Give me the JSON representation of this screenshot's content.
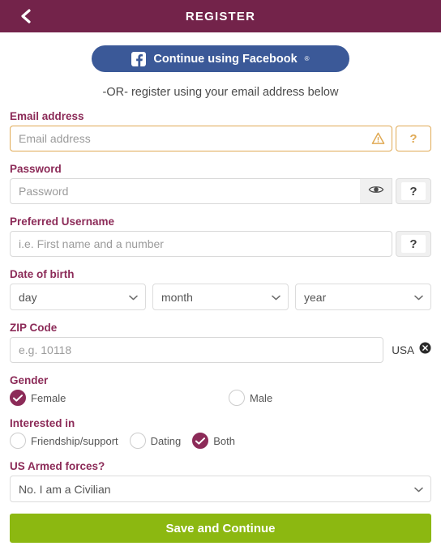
{
  "theme": {
    "header_bg": "#73234a",
    "label_color": "#8c2b58",
    "accent_maroon": "#8c2b58",
    "facebook_blue": "#3b5998",
    "warning_amber": "#e0aa55",
    "save_green": "#8cb811"
  },
  "header": {
    "title": "REGISTER",
    "back_icon": "chevron-left-icon"
  },
  "social": {
    "facebook_label": "Continue using Facebook",
    "facebook_sup": "®",
    "facebook_icon": "facebook-logo-icon"
  },
  "divider_text": "-OR- register using your email address below",
  "fields": {
    "email": {
      "label": "Email address",
      "placeholder": "Email address",
      "value": "",
      "warning_icon": "warning-triangle-icon",
      "help_label": "?"
    },
    "password": {
      "label": "Password",
      "placeholder": "Password",
      "value": "",
      "reveal_icon": "eye-icon",
      "help_label": "?"
    },
    "username": {
      "label": "Preferred Username",
      "placeholder": "i.e. First name and a number",
      "value": "",
      "help_label": "?"
    },
    "dob": {
      "label": "Date of birth",
      "day": {
        "selected": "day",
        "options": [
          "day"
        ]
      },
      "month": {
        "selected": "month",
        "options": [
          "month"
        ]
      },
      "year": {
        "selected": "year",
        "options": [
          "year"
        ]
      }
    },
    "zip": {
      "label": "ZIP Code",
      "placeholder": "e.g. 10118",
      "value": "",
      "country": "USA",
      "clear_icon": "circle-x-icon"
    },
    "gender": {
      "label": "Gender",
      "options": [
        {
          "label": "Female",
          "selected": true
        },
        {
          "label": "Male",
          "selected": false
        }
      ]
    },
    "interested_in": {
      "label": "Interested in",
      "options": [
        {
          "label": "Friendship/support",
          "selected": false
        },
        {
          "label": "Dating",
          "selected": false
        },
        {
          "label": "Both",
          "selected": true
        }
      ]
    },
    "armed_forces": {
      "label": "US Armed forces?",
      "selected": "No. I am a Civilian",
      "options": [
        "No. I am a Civilian"
      ]
    }
  },
  "submit": {
    "label": "Save and Continue"
  }
}
